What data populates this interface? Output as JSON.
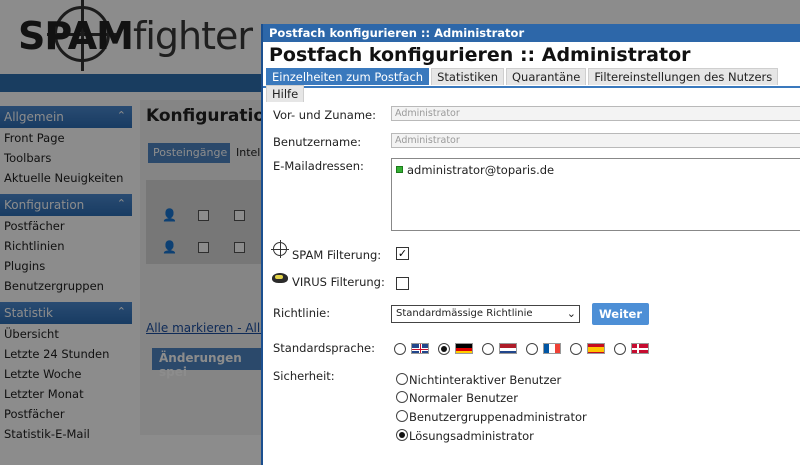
{
  "background": {
    "logo": {
      "part1": "SPAM",
      "part2": "fighter"
    },
    "sidebar": [
      {
        "header": "Allgemein",
        "items": [
          "Front Page",
          "Toolbars",
          "Aktuelle Neuigkeiten"
        ]
      },
      {
        "header": "Konfiguration",
        "items": [
          "Postfächer",
          "Richtlinien",
          "Plugins",
          "Benutzergruppen"
        ]
      },
      {
        "header": "Statistik",
        "items": [
          "Übersicht",
          "Letzte 24 Stunden",
          "Letzte Woche",
          "Letzter Monat",
          "Postfächer",
          "Statistik-E-Mail"
        ]
      }
    ],
    "main": {
      "title": "Konfiguratio",
      "tab_active": "Posteingänge",
      "tab_other": "Intel",
      "links": "Alle markieren - Alle",
      "button": "Änderungen spei"
    }
  },
  "dialog": {
    "titlebar": "Postfach konfigurieren :: Administrator",
    "heading": "Postfach konfigurieren :: Administrator",
    "tabs": [
      {
        "label": "Einzelheiten zum Postfach",
        "active": true
      },
      {
        "label": "Statistiken",
        "active": false
      },
      {
        "label": "Quarantäne",
        "active": false
      },
      {
        "label": "Filtereinstellungen des Nutzers",
        "active": false
      },
      {
        "label": "Hilfe",
        "active": false
      }
    ],
    "fields": {
      "name_label": "Vor- und Zuname:",
      "name_value": "Administrator",
      "username_label": "Benutzername:",
      "username_value": "Administrator",
      "email_label": "E-Mailadressen:",
      "email_value": "administrator@toparis.de",
      "spam_label": "SPAM Filterung:",
      "spam_checked": true,
      "virus_label": "VIRUS Filterung:",
      "virus_checked": false,
      "policy_label": "Richtlinie:",
      "policy_value": "Standardmässige Richtlinie",
      "weiter_label": "Weiter",
      "language_label": "Standardsprache:",
      "languages": [
        {
          "code": "en",
          "selected": false
        },
        {
          "code": "de",
          "selected": true
        },
        {
          "code": "nl",
          "selected": false
        },
        {
          "code": "fr",
          "selected": false
        },
        {
          "code": "es",
          "selected": false
        },
        {
          "code": "dk",
          "selected": false
        }
      ],
      "security_label": "Sicherheit:",
      "security_options": [
        {
          "label": "Nichtinteraktiver Benutzer",
          "selected": false
        },
        {
          "label": "Normaler Benutzer",
          "selected": false
        },
        {
          "label": "Benutzergruppenadministrator",
          "selected": false
        },
        {
          "label": "Lösungsadministrator",
          "selected": true
        }
      ]
    }
  },
  "colors": {
    "accent": "#3a79bd",
    "titlebar": "#2d67a9",
    "sidebar_header": "#2d6db4",
    "email_status": "#35b034"
  }
}
